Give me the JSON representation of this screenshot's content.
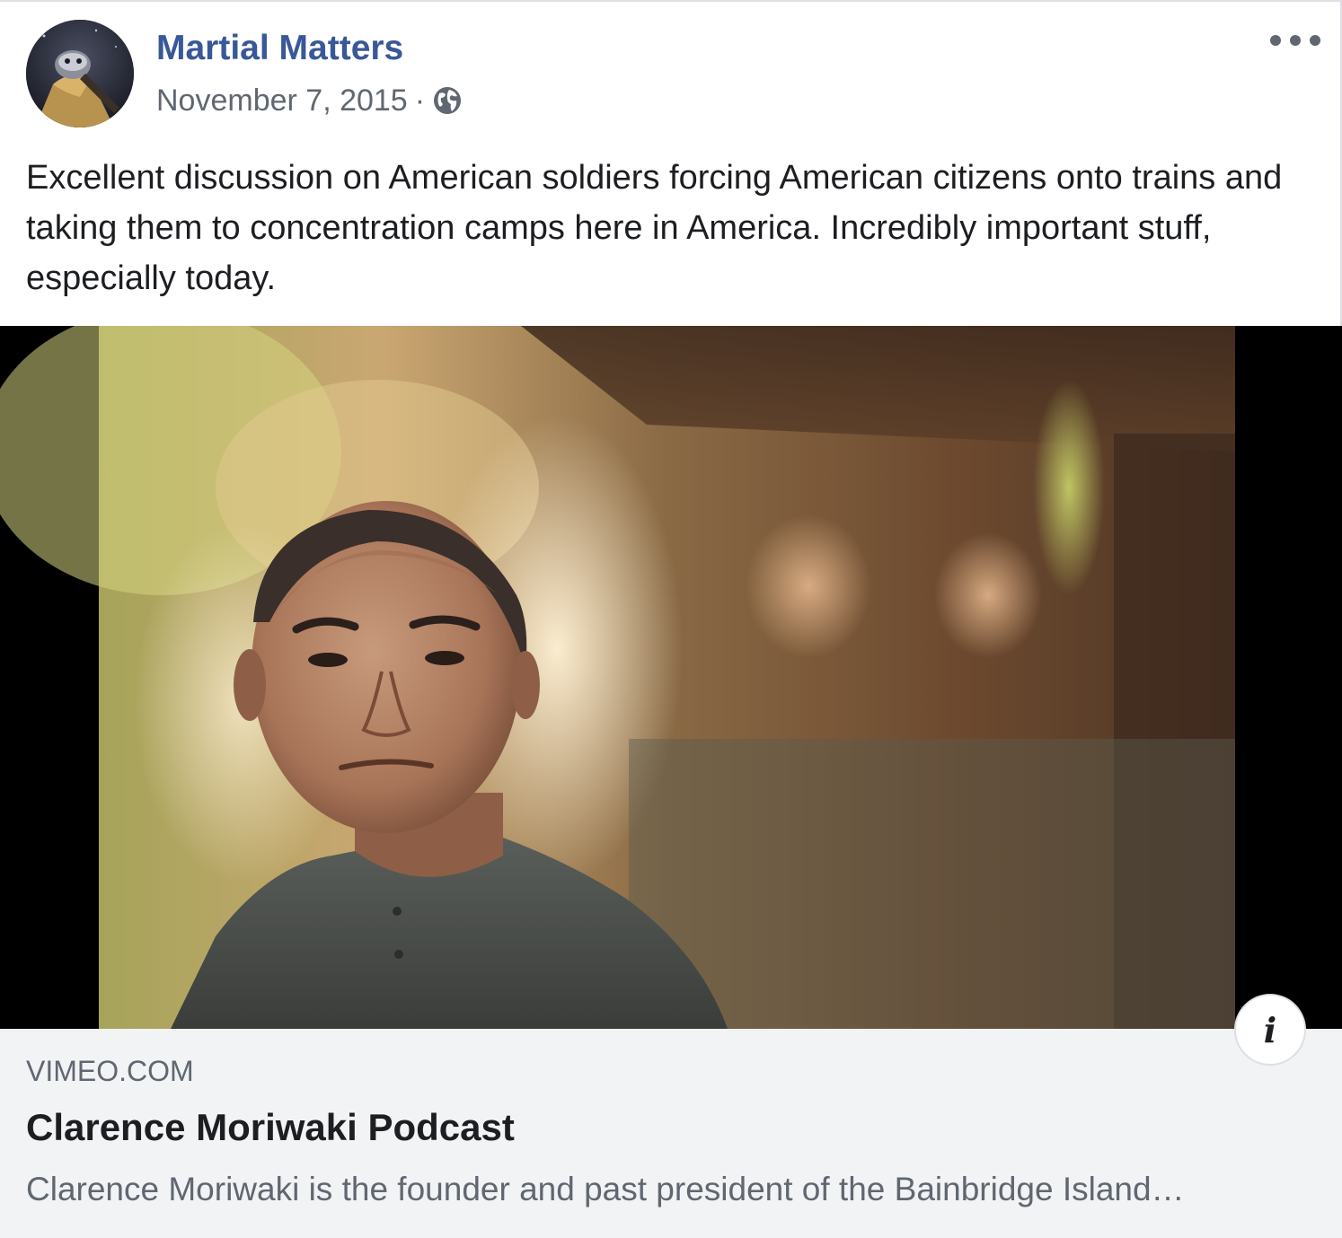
{
  "post": {
    "page_name": "Martial Matters",
    "date": "November 7, 2015",
    "separator": "·",
    "privacy_icon": "globe-icon",
    "more_icon": "more-options-icon",
    "text": "Excellent discussion on American soldiers forcing American citizens onto trains and taking them to concentration camps here in America. Incredibly important stuff, especially today."
  },
  "link_preview": {
    "domain": "VIMEO.COM",
    "title": "Clarence Moriwaki Podcast",
    "description": "Clarence Moriwaki is the founder and past president of the Bainbridge Island…",
    "info_icon_glyph": "i"
  },
  "colors": {
    "page_name": "#385898",
    "secondary_text": "#606770",
    "primary_text": "#1c1e21",
    "card_background": "#f2f3f5"
  }
}
